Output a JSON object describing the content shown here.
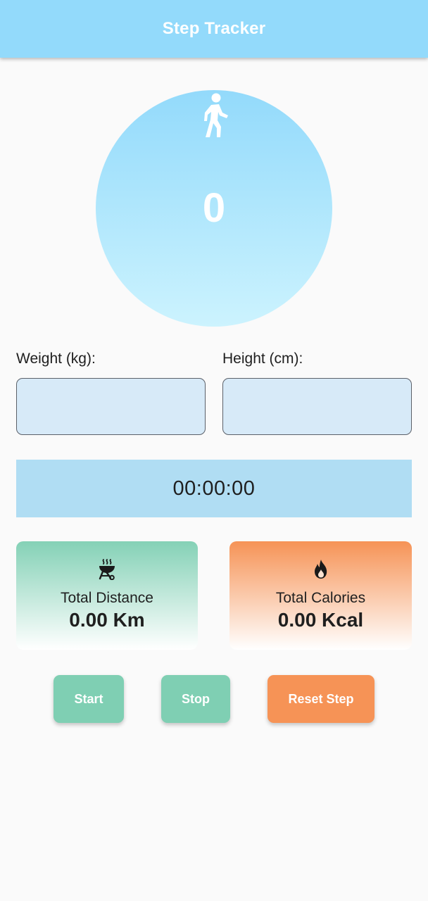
{
  "appbar": {
    "title": "Step Tracker"
  },
  "step_display": {
    "icon": "walking-person-icon",
    "count": "0"
  },
  "inputs": {
    "weight": {
      "label": "Weight (kg):",
      "value": "",
      "placeholder": ""
    },
    "height": {
      "label": "Height (cm):",
      "value": "",
      "placeholder": ""
    }
  },
  "timer": {
    "value": "00:00:00"
  },
  "stats": {
    "distance": {
      "icon": "grill-icon",
      "label": "Total Distance",
      "value": "0.00 Km"
    },
    "calories": {
      "icon": "fire-icon",
      "label": "Total Calories",
      "value": "0.00 Kcal"
    }
  },
  "buttons": {
    "start": "Start",
    "stop": "Stop",
    "reset": "Reset Step"
  },
  "colors": {
    "appbar": "#93dafb",
    "circle_top": "#93dafb",
    "circle_bottom": "#ccf3fe",
    "input_fill": "#d7eaf8",
    "timer_fill": "#b0ddf3",
    "green_accent": "#7fcfb3",
    "orange_accent": "#f69356"
  }
}
